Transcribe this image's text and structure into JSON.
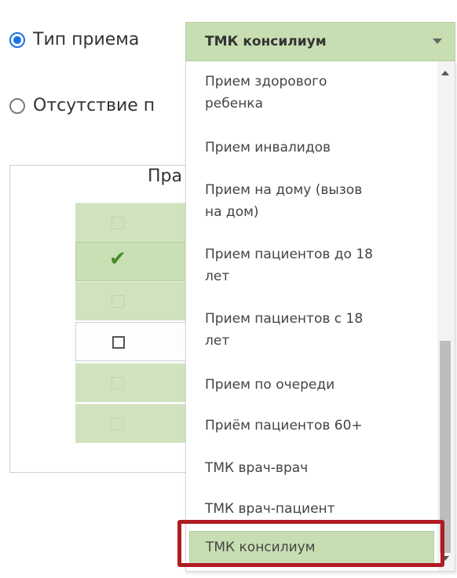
{
  "radio_options": [
    {
      "label": "Тип приема",
      "checked": true
    },
    {
      "label": "Отсутствие п",
      "checked": false
    }
  ],
  "group_legend": "Пра",
  "grid_rows": [
    {
      "checked": false
    },
    {
      "checked": true
    },
    {
      "checked": false
    },
    {
      "checked": false
    },
    {
      "checked": false
    },
    {
      "checked": false
    }
  ],
  "select": {
    "value": "ТМК консилиум",
    "options": [
      "Прием здорового\nребенка",
      "Прием инвалидов",
      "Прием на дому (вызов\nна дом)",
      "Прием пациентов до 18\nлет",
      "Прием пациентов с 18\nлет",
      "Прием по очереди",
      "Приём пациентов 60+",
      "ТМК врач-врач",
      "ТМК врач-пациент",
      "ТМК консилиум"
    ],
    "selected_index": 9
  },
  "colors": {
    "select_bg": "#c7deb2",
    "radio_accent": "#1a73e8",
    "highlight_border": "#b01c22",
    "grid_bg": "#cfe3bf"
  }
}
